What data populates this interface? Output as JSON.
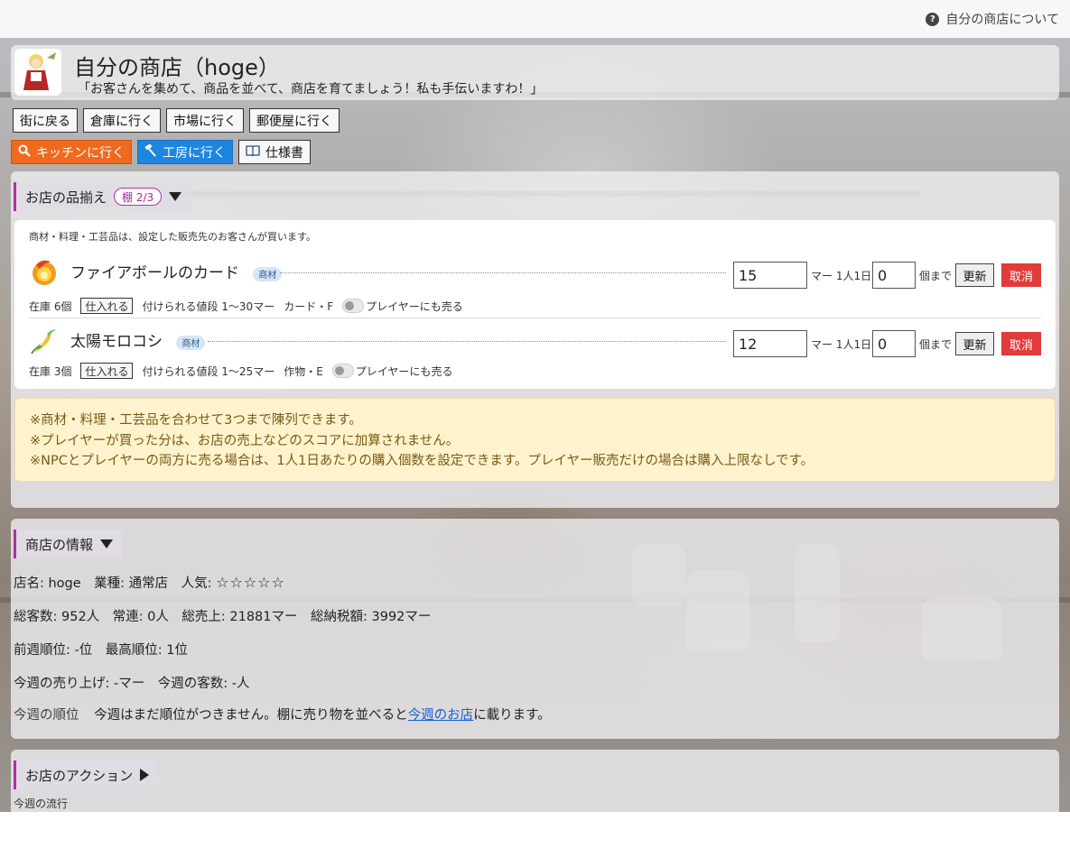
{
  "topbar": {
    "help_link": "自分の商店について",
    "help_icon": "question-circle-icon"
  },
  "header": {
    "title": "自分の商店（hoge）",
    "subtitle": "「お客さんを集めて、商品を並べて、商店を育てましょう！私も手伝いますわ！」"
  },
  "nav": {
    "row1": [
      "街に戻る",
      "倉庫に行く",
      "市場に行く",
      "郵便屋に行く"
    ],
    "kitchen": "キッチンに行く",
    "workshop": "工房に行く",
    "spec": "仕様書"
  },
  "products": {
    "heading": "お店の品揃え",
    "shelf_badge": "棚 2/3",
    "note": "商材・料理・工芸品は、設定した販売先のお客さんが買います。",
    "items": [
      {
        "name": "ファイアボールのカード",
        "tag": "商材",
        "price": "15",
        "price_unit": "マー 1人1日",
        "qty": "0",
        "qty_unit": "個まで",
        "update": "更新",
        "cancel": "取消",
        "stock": "在庫 6個",
        "restock": "仕入れる",
        "price_range": "付けられる値段 1〜30マー",
        "category": "カード・F",
        "sell_player": "プレイヤーにも売る"
      },
      {
        "name": "太陽モロコシ",
        "tag": "商材",
        "price": "12",
        "price_unit": "マー 1人1日",
        "qty": "0",
        "qty_unit": "個まで",
        "update": "更新",
        "cancel": "取消",
        "stock": "在庫 3個",
        "restock": "仕入れる",
        "price_range": "付けられる値段 1〜25マー",
        "category": "作物・E",
        "sell_player": "プレイヤーにも売る"
      }
    ],
    "notices": [
      "※商材・料理・工芸品を合わせて3つまで陳列できます。",
      "※プレイヤーが買った分は、お店の売上などのスコアに加算されません。",
      "※NPCとプレイヤーの両方に売る場合は、1人1日あたりの購入個数を設定できます。プレイヤー販売だけの場合は購入上限なしです。"
    ]
  },
  "info": {
    "heading": "商店の情報",
    "line1": "店名: hoge　業種: 通常店　人気: ",
    "stars": "☆☆☆☆☆",
    "line2": "総客数: 952人　常連: 0人　総売上: 21881マー　総納税額: 3992マー",
    "line3": "前週順位: -位　最高順位: 1位",
    "line4": "今週の売り上げ: -マー　今週の客数: -人",
    "line5_label": "今週の順位",
    "line5_text": "今週はまだ順位がつきません。棚に売り物を並べると",
    "line5_link": "今週のお店",
    "line5_tail": "に載ります。"
  },
  "actions": {
    "heading": "お店のアクション",
    "trend_label": "今週の流行"
  },
  "colors": {
    "accent_purple": "#b02fa8",
    "kitchen_orange": "#ef6a1e",
    "workshop_blue": "#1f86e0",
    "cancel_red": "#e23b3b",
    "notice_bg": "#fff3cd"
  }
}
